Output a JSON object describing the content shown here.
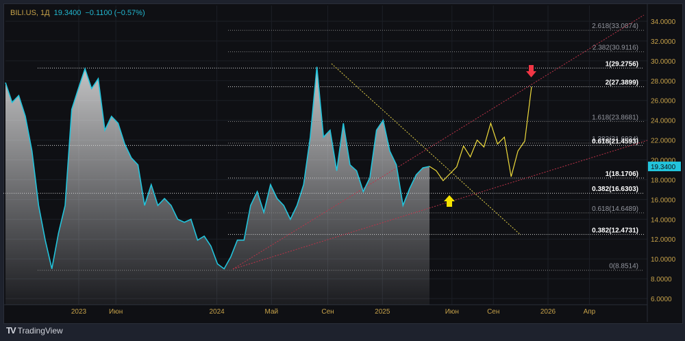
{
  "legend": {
    "symbol": "BILI.US, 1Д",
    "price": "19.3400",
    "change": "−0.1100 (−0.57%)"
  },
  "branding": {
    "logo": "TradingView"
  },
  "colors": {
    "price": "#22c4dc",
    "forecast": "#f0dc3c",
    "axis_text": "#c8a34a",
    "last_badge": "#22c4dc",
    "up_arrow": "#f5e200",
    "down_arrow": "#f23645"
  },
  "chart_data": {
    "type": "line",
    "title": "BILI.US, 1Д",
    "ylim": [
      6,
      34
    ],
    "y_ticks": [
      "34.0000",
      "32.0000",
      "30.0000",
      "28.0000",
      "26.0000",
      "24.0000",
      "22.0000",
      "20.0000",
      "18.0000",
      "16.0000",
      "14.0000",
      "12.0000",
      "10.0000",
      "8.0000",
      "6.0000"
    ],
    "x_ticks": [
      {
        "label": "2023",
        "t": 0.166
      },
      {
        "label": "Июн",
        "t": 0.39
      },
      {
        "label": "2024",
        "t": 1.0
      },
      {
        "label": "Май",
        "t": 1.33
      },
      {
        "label": "Сен",
        "t": 1.67
      },
      {
        "label": "2025",
        "t": 2.0
      },
      {
        "label": "Июн",
        "t": 2.42
      },
      {
        "label": "Сен",
        "t": 2.67
      },
      {
        "label": "2026",
        "t": 3.0
      },
      {
        "label": "Апр",
        "t": 3.25
      }
    ],
    "last_price": "19.3400",
    "price_series": [
      27.8,
      25.8,
      26.5,
      24.4,
      20.9,
      15.4,
      11.9,
      9.0,
      12.6,
      15.4,
      25.1,
      27.2,
      29.2,
      27.2,
      28.2,
      23.0,
      24.4,
      23.7,
      21.6,
      20.2,
      19.5,
      15.4,
      17.5,
      15.4,
      16.1,
      15.4,
      14.0,
      13.7,
      14.0,
      11.9,
      12.3,
      11.3,
      9.5,
      9.0,
      10.2,
      11.9,
      11.9,
      15.4,
      16.8,
      14.7,
      17.5,
      16.1,
      15.4,
      14.0,
      15.4,
      17.5,
      22.3,
      29.4,
      22.3,
      23.0,
      18.9,
      23.7,
      19.5,
      18.9,
      16.8,
      18.2,
      23.0,
      24.0,
      20.9,
      19.5,
      15.4,
      17.1,
      18.5,
      19.2,
      19.34
    ],
    "forecast_series": [
      19.34,
      18.9,
      17.9,
      18.6,
      19.3,
      21.4,
      20.3,
      22.0,
      21.3,
      23.7,
      21.6,
      22.3,
      18.3,
      20.9,
      21.9,
      27.39
    ],
    "fib_levels": [
      {
        "label": "2.618(33.0874)",
        "value": 33.0874,
        "strong": false
      },
      {
        "label": "2.382(30.9116)",
        "value": 30.9116,
        "strong": false
      },
      {
        "label": "1(29.2756)",
        "value": 29.2756,
        "strong": true
      },
      {
        "label": "2(27.3899)",
        "value": 27.3899,
        "strong": true
      },
      {
        "label": "1.618(23.8681)",
        "value": 23.8681,
        "strong": false
      },
      {
        "label": "1.382(21.6934)",
        "value": 21.6934,
        "strong": false
      },
      {
        "label": "0.618(21.4593)",
        "value": 21.4593,
        "strong": true
      },
      {
        "label": "1(18.1706)",
        "value": 18.1706,
        "strong": true
      },
      {
        "label": "0.382(16.6303)",
        "value": 16.6303,
        "strong": true
      },
      {
        "label": "0.618(14.6489)",
        "value": 14.6489,
        "strong": false
      },
      {
        "label": "0.382(12.4731)",
        "value": 12.4731,
        "strong": true
      },
      {
        "label": "0(8.8514)",
        "value": 8.8514,
        "strong": false
      }
    ]
  }
}
